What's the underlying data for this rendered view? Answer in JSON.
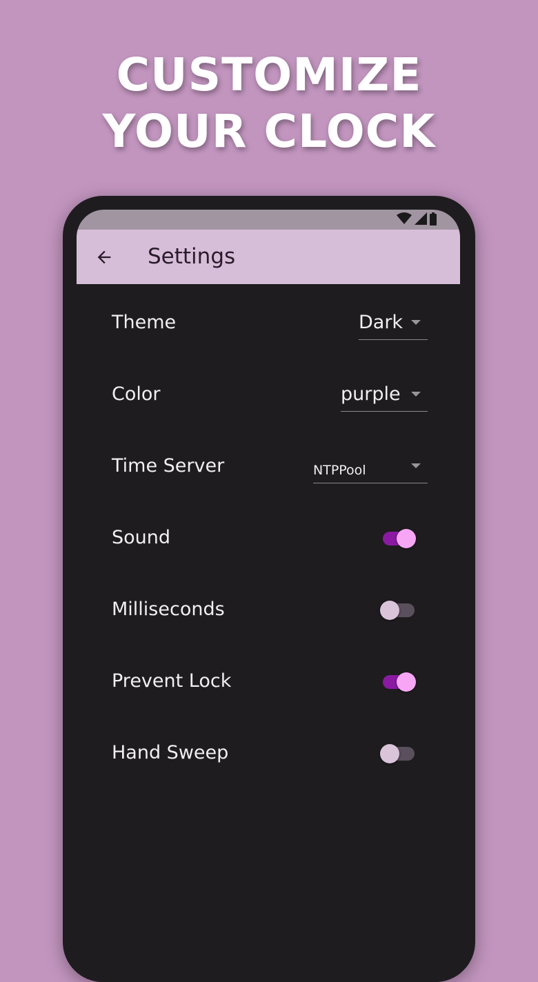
{
  "headline": {
    "line1": "CUSTOMIZE",
    "line2": "YOUR CLOCK"
  },
  "app_bar": {
    "title": "Settings",
    "back_icon": "arrow-back-icon"
  },
  "status_bar": {
    "icons": [
      "wifi-icon",
      "signal-icon",
      "battery-icon"
    ]
  },
  "settings": {
    "theme": {
      "label": "Theme",
      "value": "Dark"
    },
    "color": {
      "label": "Color",
      "value": "purple"
    },
    "time_server": {
      "label": "Time Server",
      "value": "NTPPool"
    },
    "sound": {
      "label": "Sound",
      "on": true
    },
    "milliseconds": {
      "label": "Milliseconds",
      "on": false
    },
    "prevent_lock": {
      "label": "Prevent Lock",
      "on": true
    },
    "hand_sweep": {
      "label": "Hand Sweep",
      "on": false
    }
  },
  "colors": {
    "background": "#c295bf",
    "app_bar": "#d7bed8",
    "screen": "#1e1c1f",
    "switch_on_track": "#8b1aa3",
    "switch_on_thumb": "#f7a6f6",
    "switch_off_track": "#5a4f5c",
    "switch_off_thumb": "#d9c4d9"
  }
}
